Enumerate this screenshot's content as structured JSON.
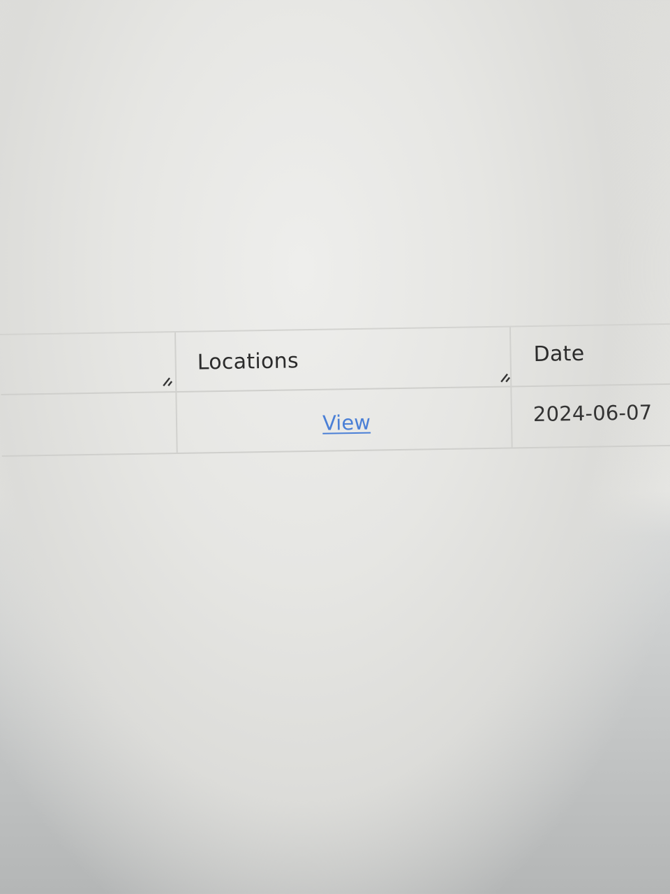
{
  "table": {
    "columns": [
      {
        "label": ""
      },
      {
        "label": "Locations"
      },
      {
        "label": "Date"
      }
    ],
    "rows": [
      {
        "cells": [
          "",
          "View",
          "2024-06-07"
        ]
      }
    ]
  },
  "icons": {
    "resize": "column-resize-icon"
  }
}
